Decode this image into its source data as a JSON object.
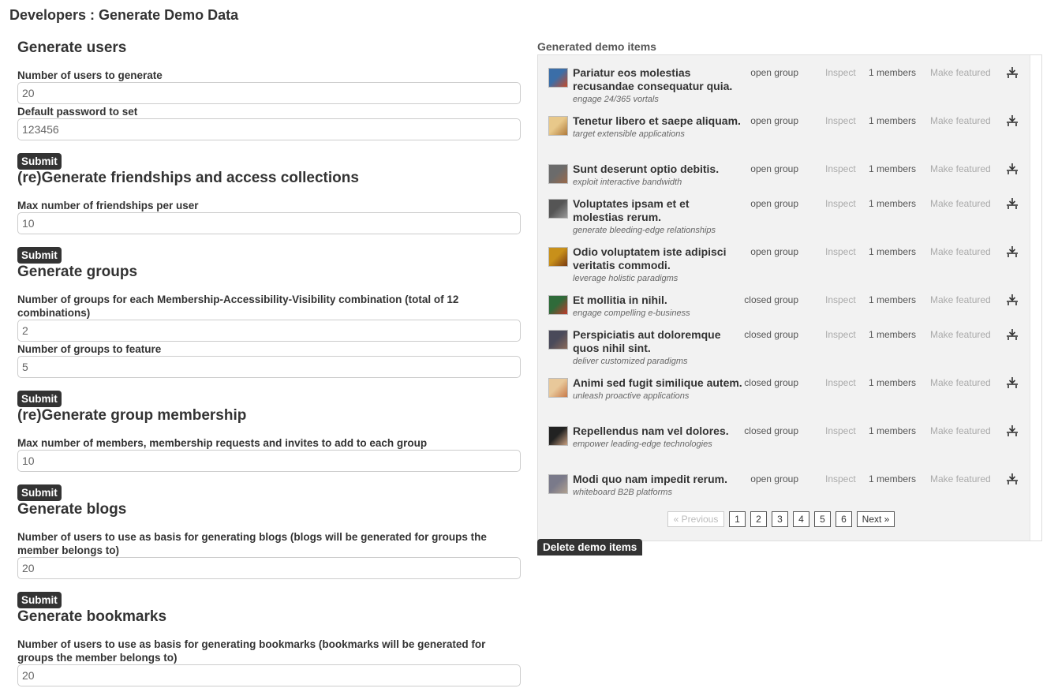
{
  "page_title": "Developers : Generate Demo Data",
  "forms": {
    "users": {
      "heading": "Generate users",
      "count_label": "Number of users to generate",
      "count_value": "20",
      "password_label": "Default password to set",
      "password_value": "123456",
      "submit": "Submit"
    },
    "friendships": {
      "heading": "(re)Generate friendships and access collections",
      "max_label": "Max number of friendships per user",
      "max_value": "10",
      "submit": "Submit"
    },
    "groups": {
      "heading": "Generate groups",
      "count_label": "Number of groups for each Membership-Accessibility-Visibility combination (total of 12 combinations)",
      "count_value": "2",
      "feature_label": "Number of groups to feature",
      "feature_value": "5",
      "submit": "Submit"
    },
    "membership": {
      "heading": "(re)Generate group membership",
      "max_label": "Max number of members, membership requests and invites to add to each group",
      "max_value": "10",
      "submit": "Submit"
    },
    "blogs": {
      "heading": "Generate blogs",
      "users_label": "Number of users to use as basis for generating blogs (blogs will be generated for groups the member belongs to)",
      "users_value": "20",
      "submit": "Submit"
    },
    "bookmarks": {
      "heading": "Generate bookmarks",
      "users_label": "Number of users to use as basis for generating bookmarks (bookmarks will be generated for groups the member belongs to)",
      "users_value": "20"
    }
  },
  "demo_items": {
    "heading": "Generated demo items",
    "action_labels": {
      "inspect": "Inspect",
      "make_featured": "Make featured"
    },
    "items": [
      {
        "title": "Pariatur eos molestias recusandae consequatur quia.",
        "subtitle": "engage 24/365 vortals",
        "group_type": "open group",
        "members": "1 members",
        "thumb_colors": [
          "#3b6ea8",
          "#c44a2a"
        ]
      },
      {
        "title": "Tenetur libero et saepe aliquam.",
        "subtitle": "target extensible applications",
        "group_type": "open group",
        "members": "1 members",
        "thumb_colors": [
          "#e8c88a",
          "#b07a3a"
        ]
      },
      {
        "title": "Sunt deserunt optio debitis.",
        "subtitle": "exploit interactive bandwidth",
        "group_type": "open group",
        "members": "1 members",
        "thumb_colors": [
          "#6b6b6b",
          "#9a6a4a"
        ]
      },
      {
        "title": "Voluptates ipsam et et molestias rerum.",
        "subtitle": "generate bleeding-edge relationships",
        "group_type": "open group",
        "members": "1 members",
        "thumb_colors": [
          "#555555",
          "#999999"
        ]
      },
      {
        "title": "Odio voluptatem iste adipisci veritatis commodi.",
        "subtitle": "leverage holistic paradigms",
        "group_type": "open group",
        "members": "1 members",
        "thumb_colors": [
          "#c8901a",
          "#7a3a10"
        ]
      },
      {
        "title": "Et mollitia in nihil.",
        "subtitle": "engage compelling e-business",
        "group_type": "closed group",
        "members": "1 members",
        "thumb_colors": [
          "#2f6b3a",
          "#c0392b"
        ]
      },
      {
        "title": "Perspiciatis aut doloremque quos nihil sint.",
        "subtitle": "deliver customized paradigms",
        "group_type": "closed group",
        "members": "1 members",
        "thumb_colors": [
          "#4a4a5a",
          "#8a6a5a"
        ]
      },
      {
        "title": "Animi sed fugit similique autem.",
        "subtitle": "unleash proactive applications",
        "group_type": "closed group",
        "members": "1 members",
        "thumb_colors": [
          "#e8c89a",
          "#c87a4a"
        ]
      },
      {
        "title": "Repellendus nam vel dolores.",
        "subtitle": "empower leading-edge technologies",
        "group_type": "closed group",
        "members": "1 members",
        "thumb_colors": [
          "#222222",
          "#c8a080"
        ]
      },
      {
        "title": "Modi quo nam impedit rerum.",
        "subtitle": "whiteboard B2B platforms",
        "group_type": "open group",
        "members": "1 members",
        "thumb_colors": [
          "#7a7a8a",
          "#b0a090"
        ]
      }
    ],
    "pagination": {
      "previous": "« Previous",
      "pages": [
        "1",
        "2",
        "3",
        "4",
        "5",
        "6"
      ],
      "current": "1",
      "next": "Next »"
    },
    "delete_button": "Delete demo items"
  }
}
